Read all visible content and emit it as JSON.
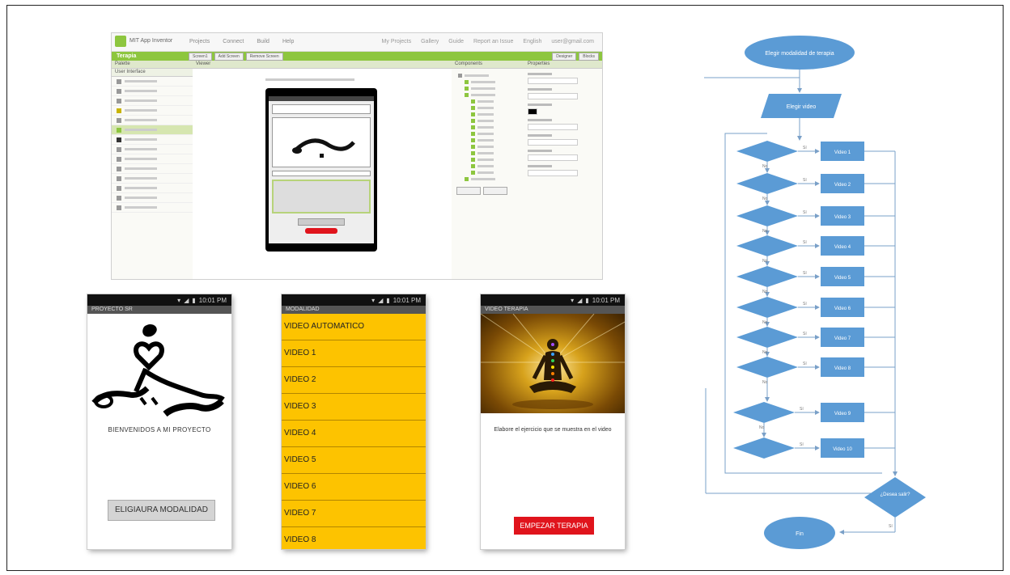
{
  "designer": {
    "brand": "MIT App Inventor",
    "menu": [
      "Projects",
      "Connect",
      "Build",
      "Help"
    ],
    "right_menu": [
      "My Projects",
      "Gallery",
      "Guide",
      "Report an Issue",
      "English",
      "user@gmail.com"
    ],
    "project_name": "Terapia",
    "toolbar": [
      "Screen1",
      "Add Screen",
      "Remove Screen"
    ],
    "mode_buttons": [
      "Designer",
      "Blocks"
    ],
    "panels": {
      "palette": "Palette",
      "viewer": "Viewer",
      "components": "Components",
      "properties": "Properties"
    },
    "palette_section": "User Interface"
  },
  "phone1": {
    "title": "PROYECTO SR",
    "welcome": "BIENVENIDOS A MI PROYECTO",
    "button": "ELIGIAURA MODALIDAD"
  },
  "phone2": {
    "title": "MODALIDAD",
    "items": [
      "VIDEO AUTOMATICO",
      "VIDEO 1",
      "VIDEO 2",
      "VIDEO 3",
      "VIDEO 4",
      "VIDEO 5",
      "VIDEO 6",
      "VIDEO 7",
      "VIDEO 8"
    ]
  },
  "phone3": {
    "title": "VIDEO TERAPIA",
    "description": "Elabore el ejercicio que se muestra en el video",
    "button": "EMPEZAR TERAPIA"
  },
  "status_time": "10:01 PM",
  "flowchart": {
    "start": "Elegir modalidad de terapia",
    "input": "Elegir video",
    "decision_end": "¿Desea salir?",
    "end": "Fin",
    "yes": "Sí",
    "no": "No",
    "options": [
      "Video 1",
      "Video 2",
      "Video 3",
      "Video 4",
      "Video 5",
      "Video 6",
      "Video 7",
      "Video 8",
      "Video 9",
      "Video 10"
    ]
  }
}
